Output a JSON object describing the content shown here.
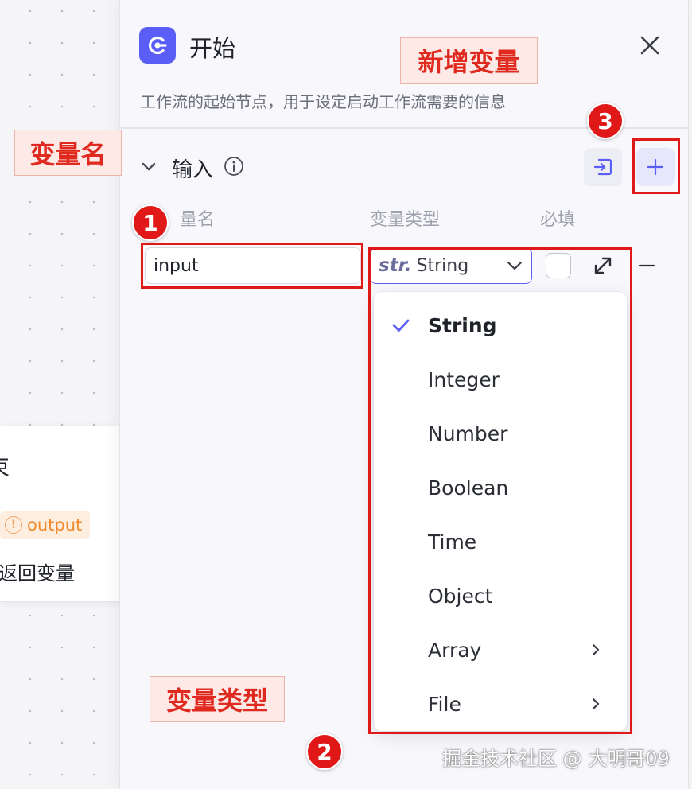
{
  "background_node": {
    "title_fragment": "束",
    "tag_label": "output",
    "desc_fragment": "返回变量"
  },
  "panel": {
    "title": "开始",
    "description": "工作流的起始节点，用于设定启动工作流需要的信息",
    "section_label": "输入",
    "columns": {
      "name": "量名",
      "type": "变量类型",
      "required": "必填"
    },
    "row": {
      "name_value": "input",
      "type_prefix": "str.",
      "type_value": "String"
    },
    "dropdown": [
      {
        "label": "String",
        "selected": true
      },
      {
        "label": "Integer"
      },
      {
        "label": "Number"
      },
      {
        "label": "Boolean"
      },
      {
        "label": "Time"
      },
      {
        "label": "Object"
      },
      {
        "label": "Array",
        "submenu": true
      },
      {
        "label": "File",
        "submenu": true
      }
    ]
  },
  "annotations": {
    "variable_name": "变量名",
    "variable_type": "变量类型",
    "add_variable": "新增变量",
    "badge_1": "1",
    "badge_2": "2",
    "badge_3": "3"
  },
  "watermark": "掘金技术社区 @ 大明哥09",
  "colors": {
    "accent": "#5b5ef6",
    "annotation_red": "#e01818",
    "tag_orange": "#ef8a2d"
  },
  "icons": {
    "start": "start-node-icon",
    "close": "close-icon",
    "chevron": "chevron-down-icon",
    "info": "info-icon",
    "import": "import-icon",
    "add": "plus-icon",
    "expand": "expand-icon",
    "remove": "minus-icon",
    "check": "check-icon",
    "submenu": "chevron-right-icon",
    "warning": "warning-icon"
  }
}
